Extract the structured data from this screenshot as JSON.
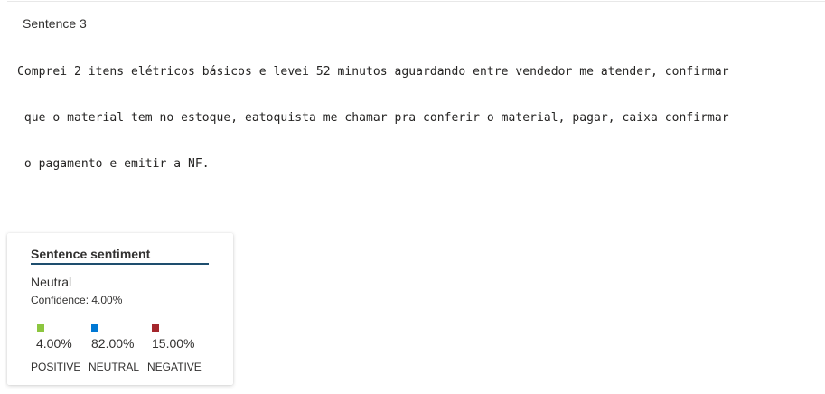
{
  "header": {
    "sentence_label": "Sentence 3"
  },
  "sentence": {
    "line1": "Comprei 2 itens elétricos básicos e levei 52 minutos aguardando entre vendedor me atender, confirmar",
    "line2": " que o material tem no estoque, eatoquista me chamar pra conferir o material, pagar, caixa confirmar",
    "line3": " o pagamento e emitir a NF."
  },
  "sentiment_card": {
    "title": "Sentence sentiment",
    "sentiment": "Neutral",
    "confidence": "Confidence: 4.00%",
    "scores": [
      {
        "label": "POSITIVE",
        "value": "4.00%",
        "color": "#8cc63f"
      },
      {
        "label": "NEUTRAL",
        "value": "82.00%",
        "color": "#0078d4"
      },
      {
        "label": "NEGATIVE",
        "value": "15.00%",
        "color": "#a4262c"
      }
    ]
  }
}
